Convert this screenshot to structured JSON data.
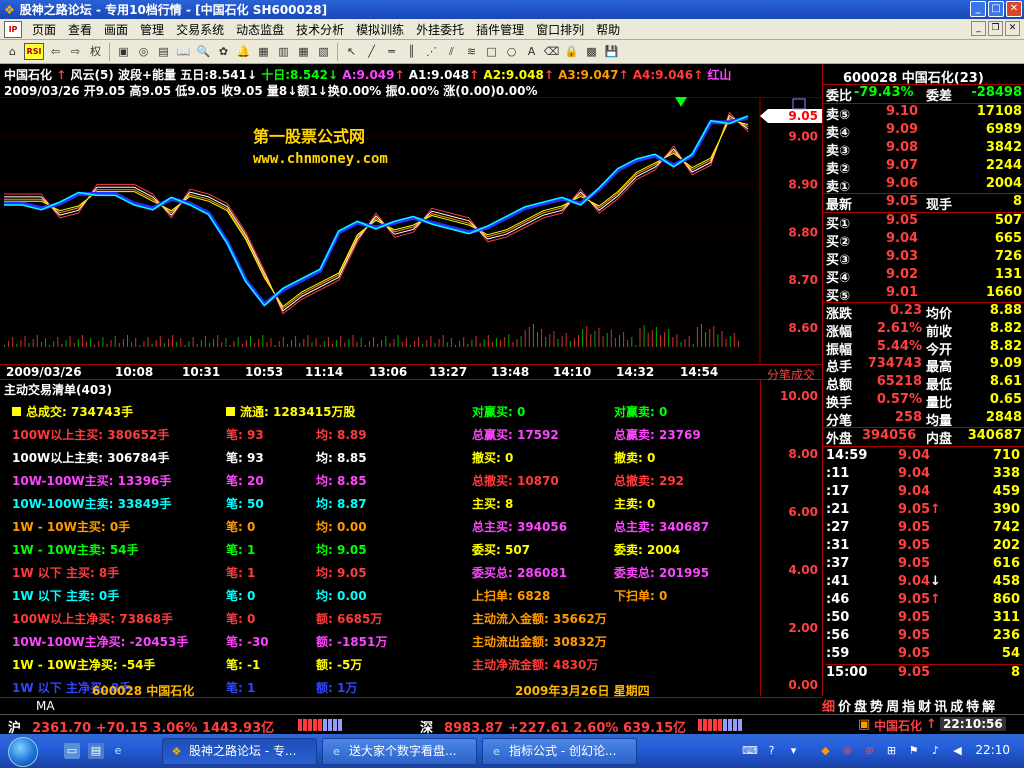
{
  "window": {
    "title": "股神之路论坛 - 专用10档行情 - [中国石化 SH600028]"
  },
  "menu": [
    "页面",
    "查看",
    "画面",
    "管理",
    "交易系统",
    "动态监盘",
    "技术分析",
    "模拟训练",
    "外挂委托",
    "插件管理",
    "窗口排列",
    "帮助"
  ],
  "chart_header": {
    "name": "中国石化",
    "indicator": "风云(5) 波段+能量",
    "wuri": "五日:8.541",
    "shiri": "十日:8.542",
    "a": "A:9.049",
    "a1": "A1:9.048",
    "a2": "A2:9.048",
    "a3": "A3:9.047",
    "a4": "A4:9.046",
    "corner": "红山",
    "line2": "2009/03/26 开9.05 高9.05 低9.05 收9.05 量8↓额1↓换0.00% 振0.00% 涨(0.00)0.00%"
  },
  "watermark": {
    "name": "第一股票公式网",
    "url": "www.chnmoney.com"
  },
  "price_axis": {
    "current": "9.05",
    "ticks": [
      "9.00",
      "8.90",
      "8.80",
      "8.70",
      "8.60"
    ]
  },
  "time_axis": {
    "labels": [
      "2009/03/26",
      "10:08",
      "10:31",
      "10:53",
      "11:14",
      "13:06",
      "13:27",
      "13:48",
      "14:10",
      "14:32",
      "14:54"
    ],
    "right_label": "分笔成交"
  },
  "chart_data": {
    "type": "line",
    "x": [
      0,
      1,
      2,
      3,
      4,
      5,
      6,
      7,
      8,
      9,
      10,
      11,
      12,
      13,
      14,
      15,
      16,
      17,
      18,
      19,
      20,
      21,
      22,
      23,
      24,
      25,
      26,
      27,
      28,
      29,
      30,
      31,
      32,
      33,
      34,
      35,
      36,
      37,
      38,
      39,
      40
    ],
    "series": [
      {
        "values": [
          8.86,
          8.86,
          8.85,
          8.86,
          8.88,
          8.88,
          8.88,
          8.86,
          8.85,
          8.87,
          8.86,
          8.84,
          8.78,
          8.7,
          8.65,
          8.68,
          8.7,
          8.72,
          8.8,
          8.82,
          8.81,
          8.82,
          8.83,
          8.82,
          8.81,
          8.8,
          8.81,
          8.83,
          8.85,
          8.86,
          8.87,
          8.86,
          8.89,
          8.93,
          8.95,
          8.96,
          8.94,
          8.96,
          9.03,
          9.03,
          9.04
        ]
      }
    ],
    "ylim": [
      8.55,
      9.07
    ]
  },
  "panel": {
    "title": "主动交易清单(403)",
    "total_volume": "总成交: 734743手",
    "float_shares": "流通: 1283415万股",
    "rows": [
      {
        "a": "100W以上主买: 380652手",
        "b": "笔: 93",
        "c": "均: 8.89",
        "color": "#ff3b3b"
      },
      {
        "a": "100W以上主卖: 306784手",
        "b": "笔: 93",
        "c": "均: 8.85",
        "color": "#ffffff"
      },
      {
        "a": "10W-100W主买: 13396手",
        "b": "笔: 20",
        "c": "均: 8.85",
        "color": "#ff44ff"
      },
      {
        "a": "10W-100W主卖: 33849手",
        "b": "笔: 50",
        "c": "均: 8.87",
        "color": "#00ffff"
      },
      {
        "a": "1W - 10W主买: 0手",
        "b": "笔: 0",
        "c": "均: 0.00",
        "color": "#ff9a00"
      },
      {
        "a": "1W - 10W主卖: 54手",
        "b": "笔: 1",
        "c": "均: 9.05",
        "color": "#00ff00"
      },
      {
        "a": "1W 以下 主买: 8手",
        "b": "笔: 1",
        "c": "均: 9.05",
        "color": "#ff3b3b"
      },
      {
        "a": "1W 以下 主卖: 0手",
        "b": "笔: 0",
        "c": "均: 0.00",
        "color": "#00ffff"
      },
      {
        "a": "100W以上主净买: 73868手",
        "b": "笔: 0",
        "c": "额: 6685万",
        "color": "#ff3b3b"
      },
      {
        "a": "10W-100W主净买: -20453手",
        "b": "笔: -30",
        "c": "额: -1851万",
        "color": "#ff44ff"
      },
      {
        "a": "1W - 10W主净买: -54手",
        "b": "笔: -1",
        "c": "额: -5万",
        "color": "#ffff00"
      },
      {
        "a": "1W 以下 主净买: 8手",
        "b": "笔: 1",
        "c": "额: 1万",
        "color": "#3344ff"
      }
    ],
    "mid": [
      {
        "a": "对赢买: 0",
        "b": "对赢卖: 0",
        "color": "#00ff00"
      },
      {
        "a": "总赢买: 17592",
        "b": "总赢卖: 23769",
        "color": "#ff44ff"
      },
      {
        "a": "撤买: 0",
        "b": "撤卖: 0",
        "color": "#ffff00"
      },
      {
        "a": "总撤买: 10870",
        "b": "总撤卖: 292",
        "color": "#ff3b3b"
      },
      {
        "a": "主买: 8",
        "b": "主卖: 0",
        "color": "#ffff00"
      },
      {
        "a": "总主买: 394056",
        "b": "总主卖: 340687",
        "color": "#ff44ff"
      },
      {
        "a": "委买: 507",
        "b": "委卖: 2004",
        "color": "#ffff00"
      },
      {
        "a": "委买总: 286081",
        "b": "委卖总: 201995",
        "color": "#ff44ff"
      },
      {
        "a": "上扫单: 6828",
        "b": "下扫单: 0",
        "color": "#ff9a00"
      },
      {
        "a": "主动流入金额: 35662万",
        "b": "",
        "color": "#ff9a00"
      },
      {
        "a": "主动流出金额: 30832万",
        "b": "",
        "color": "#ff9a00"
      },
      {
        "a": "主动净流金额: 4830万",
        "b": "",
        "color": "#ff3b3b"
      }
    ],
    "footer_code": "600028 中国石化",
    "footer_date": "2009年3月26日 星期四"
  },
  "vol_axis": [
    "10.00",
    "8.00",
    "6.00",
    "4.00",
    "2.00",
    "0.00"
  ],
  "ma_label": "MA",
  "quote": {
    "title": "600028 中国石化(23)",
    "weibi": "委比",
    "weibi_val": "-79.43%",
    "weicha": "委差",
    "weicha_val": "-28498",
    "sells": [
      {
        "label": "卖⑤",
        "price": "9.10",
        "vol": "17108"
      },
      {
        "label": "卖④",
        "price": "9.09",
        "vol": "6989"
      },
      {
        "label": "卖③",
        "price": "9.08",
        "vol": "3842"
      },
      {
        "label": "卖②",
        "price": "9.07",
        "vol": "2244"
      },
      {
        "label": "卖①",
        "price": "9.06",
        "vol": "2004"
      }
    ],
    "latest": {
      "label": "最新",
      "price": "9.05",
      "label2": "现手",
      "vol": "8"
    },
    "buys": [
      {
        "label": "买①",
        "price": "9.05",
        "vol": "507"
      },
      {
        "label": "买②",
        "price": "9.04",
        "vol": "665"
      },
      {
        "label": "买③",
        "price": "9.03",
        "vol": "726"
      },
      {
        "label": "买④",
        "price": "9.02",
        "vol": "131"
      },
      {
        "label": "买⑤",
        "price": "9.01",
        "vol": "1660"
      }
    ],
    "stats": [
      {
        "l1": "涨跌",
        "v1": "0.23",
        "l2": "均价",
        "v2": "8.88"
      },
      {
        "l1": "涨幅",
        "v1": "2.61%",
        "l2": "前收",
        "v2": "8.82"
      },
      {
        "l1": "振幅",
        "v1": "5.44%",
        "l2": "今开",
        "v2": "8.82"
      },
      {
        "l1": "总手",
        "v1": "734743",
        "l2": "最高",
        "v2": "9.09"
      },
      {
        "l1": "总额",
        "v1": "65218",
        "l2": "最低",
        "v2": "8.61"
      },
      {
        "l1": "换手",
        "v1": "0.57%",
        "l2": "量比",
        "v2": "0.65"
      },
      {
        "l1": "分笔",
        "v1": "258",
        "l2": "均量",
        "v2": "2848"
      }
    ],
    "waipan": {
      "l1": "外盘",
      "v1": "394056",
      "l2": "内盘",
      "v2": "340687"
    },
    "ticks": [
      {
        "t": "14:59",
        "p": "9.04",
        "ar": "",
        "v": "710"
      },
      {
        "t": ":11",
        "p": "9.04",
        "ar": "",
        "v": "338"
      },
      {
        "t": ":17",
        "p": "9.04",
        "ar": "",
        "v": "459"
      },
      {
        "t": ":21",
        "p": "9.05",
        "ar": "↑",
        "v": "390"
      },
      {
        "t": ":27",
        "p": "9.05",
        "ar": "",
        "v": "742"
      },
      {
        "t": ":31",
        "p": "9.05",
        "ar": "",
        "v": "202"
      },
      {
        "t": ":37",
        "p": "9.05",
        "ar": "",
        "v": "616"
      },
      {
        "t": ":41",
        "p": "9.04",
        "ar": "↓",
        "v": "458"
      },
      {
        "t": ":46",
        "p": "9.05",
        "ar": "↑",
        "v": "860"
      },
      {
        "t": ":50",
        "p": "9.05",
        "ar": "",
        "v": "311"
      },
      {
        "t": ":56",
        "p": "9.05",
        "ar": "",
        "v": "236"
      },
      {
        "t": ":59",
        "p": "9.05",
        "ar": "",
        "v": "54"
      },
      {
        "t": "15:00",
        "p": "9.05",
        "ar": "",
        "v": "8"
      }
    ],
    "tabs": [
      "细",
      "价",
      "盘",
      "势",
      "周",
      "指",
      "财",
      "讯",
      "成",
      "特",
      "解"
    ]
  },
  "index_bar": {
    "sh_label": "沪",
    "sh_value": "2361.70 +70.15 3.06% 1443.93亿",
    "sz_label": "深",
    "sz_value": "8983.87 +227.61 2.60% 639.15亿",
    "right_name": "中国石化",
    "time": "22:10:56"
  },
  "taskbar": {
    "tasks": [
      "股神之路论坛 - 专...",
      "送大家个数字看盘...",
      "指标公式 - 创幻论..."
    ],
    "clock": "22:10"
  }
}
